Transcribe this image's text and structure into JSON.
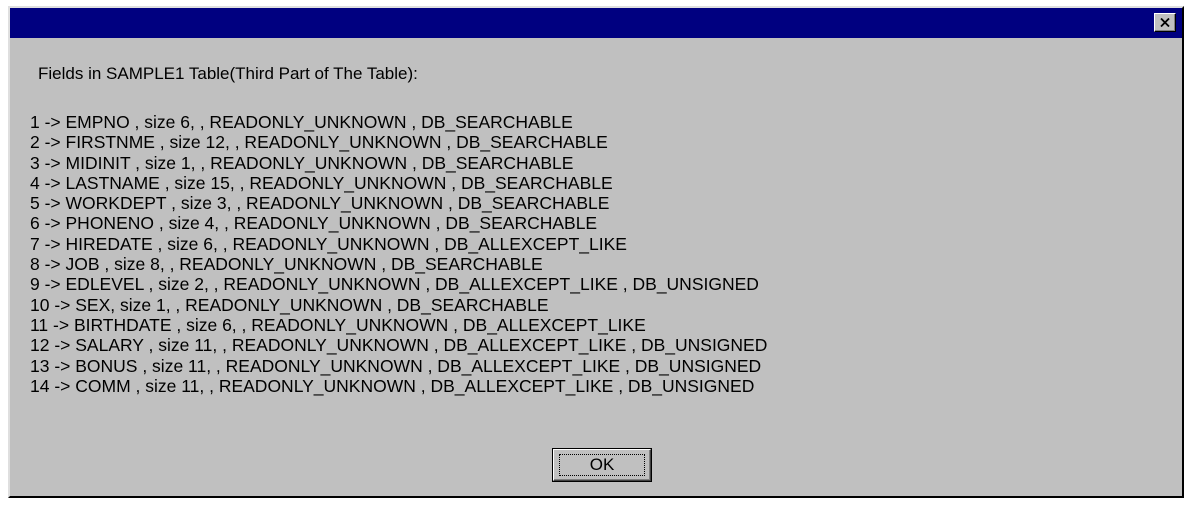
{
  "window": {
    "title": "",
    "close_icon": "close-x-icon"
  },
  "message": {
    "heading": "Fields in SAMPLE1 Table(Third Part of The Table):",
    "fields": [
      "1 -> EMPNO , size 6, , READONLY_UNKNOWN , DB_SEARCHABLE",
      "2 -> FIRSTNME , size 12, , READONLY_UNKNOWN , DB_SEARCHABLE",
      "3 -> MIDINIT , size 1, , READONLY_UNKNOWN , DB_SEARCHABLE",
      "4 -> LASTNAME , size 15, , READONLY_UNKNOWN , DB_SEARCHABLE",
      "5 -> WORKDEPT , size 3, , READONLY_UNKNOWN , DB_SEARCHABLE",
      "6 -> PHONENO , size 4, , READONLY_UNKNOWN , DB_SEARCHABLE",
      "7 -> HIREDATE , size 6, , READONLY_UNKNOWN , DB_ALLEXCEPT_LIKE",
      "8 -> JOB , size 8, , READONLY_UNKNOWN , DB_SEARCHABLE",
      "9 -> EDLEVEL , size 2, , READONLY_UNKNOWN , DB_ALLEXCEPT_LIKE , DB_UNSIGNED",
      "10 -> SEX, size 1, , READONLY_UNKNOWN , DB_SEARCHABLE",
      "11 -> BIRTHDATE , size 6, , READONLY_UNKNOWN , DB_ALLEXCEPT_LIKE",
      "12 -> SALARY , size 11, , READONLY_UNKNOWN , DB_ALLEXCEPT_LIKE , DB_UNSIGNED",
      "13 -> BONUS , size 11, , READONLY_UNKNOWN , DB_ALLEXCEPT_LIKE , DB_UNSIGNED",
      "14 -> COMM , size 11, , READONLY_UNKNOWN , DB_ALLEXCEPT_LIKE , DB_UNSIGNED"
    ]
  },
  "buttons": {
    "ok_label": "OK"
  },
  "colors": {
    "title_bar": "#000080",
    "dialog_face": "#c0c0c0",
    "text": "#000000"
  }
}
